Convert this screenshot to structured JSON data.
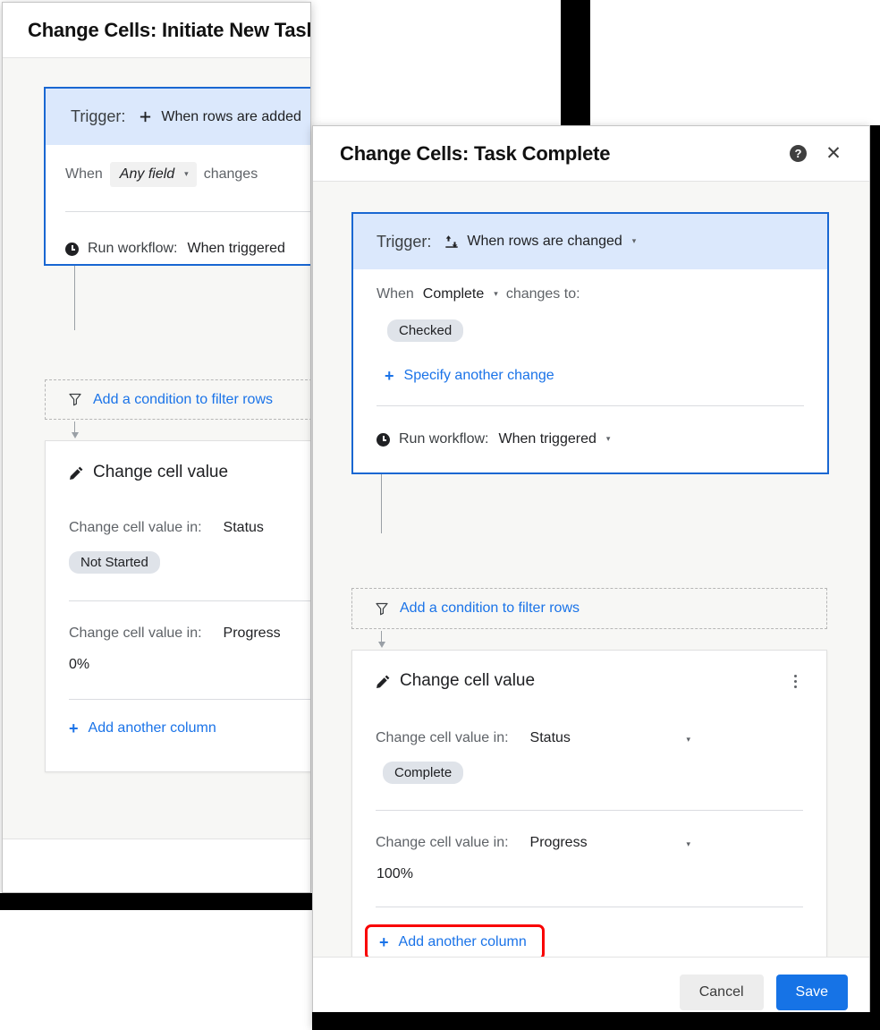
{
  "back_dialog": {
    "title": "Change Cells: Initiate New Task",
    "help_icon": "help-icon",
    "close_icon": "close-icon",
    "trigger": {
      "label": "Trigger:",
      "icon": "plus-icon",
      "value": "When rows are added",
      "caret": "▾",
      "when_prefix": "When",
      "when_field": "Any field",
      "when_caret": "▾",
      "when_suffix": "changes",
      "run_icon": "clock-icon",
      "run_label": "Run workflow:",
      "run_value": "When triggered"
    },
    "condition": {
      "icon": "funnel-icon",
      "label": "Add a condition to filter rows"
    },
    "action": {
      "icon": "pencil-icon",
      "title": "Change cell value",
      "rows": [
        {
          "label": "Change cell value in:",
          "column": "Status",
          "caret": "▾",
          "value": "Not Started",
          "value_is_chip": true
        },
        {
          "label": "Change cell value in:",
          "column": "Progress",
          "caret": "▾",
          "value": "0%",
          "value_is_chip": false
        }
      ],
      "add_column": {
        "plus": "+",
        "label": "Add another column"
      }
    }
  },
  "front_dialog": {
    "title": "Change Cells: Task Complete",
    "help_icon": "help-icon",
    "close_icon": "close-icon",
    "trigger": {
      "label": "Trigger:",
      "icon": "rows-changed-icon",
      "value": "When rows are changed",
      "caret": "▾",
      "when_prefix": "When",
      "when_field": "Complete",
      "when_caret": "▾",
      "when_suffix": "changes to:",
      "chip": "Checked",
      "specify_another": {
        "plus": "+",
        "label": "Specify another change"
      },
      "run_icon": "clock-icon",
      "run_label": "Run workflow:",
      "run_value": "When triggered",
      "run_caret": "▾"
    },
    "condition": {
      "icon": "funnel-icon",
      "label": "Add a condition to filter rows"
    },
    "action": {
      "icon": "pencil-icon",
      "title": "Change cell value",
      "kebab_icon": "more-options-icon",
      "rows": [
        {
          "label": "Change cell value in:",
          "column": "Status",
          "caret": "▾",
          "value": "Complete",
          "value_is_chip": true
        },
        {
          "label": "Change cell value in:",
          "column": "Progress",
          "caret": "▾",
          "value": "100%",
          "value_is_chip": false
        }
      ],
      "add_column": {
        "plus": "+",
        "label": "Add another column",
        "highlighted": true
      }
    },
    "footer": {
      "cancel_label": "Cancel",
      "save_label": "Save"
    }
  },
  "colors": {
    "accent_blue": "#1a73e8",
    "trigger_border": "#1967d2",
    "trigger_header_bg": "#dbe8fc",
    "chip_bg": "#dfe3e9",
    "body_bg": "#f7f7f5",
    "save_button": "#1673e6",
    "highlight_red": "#f90000"
  }
}
